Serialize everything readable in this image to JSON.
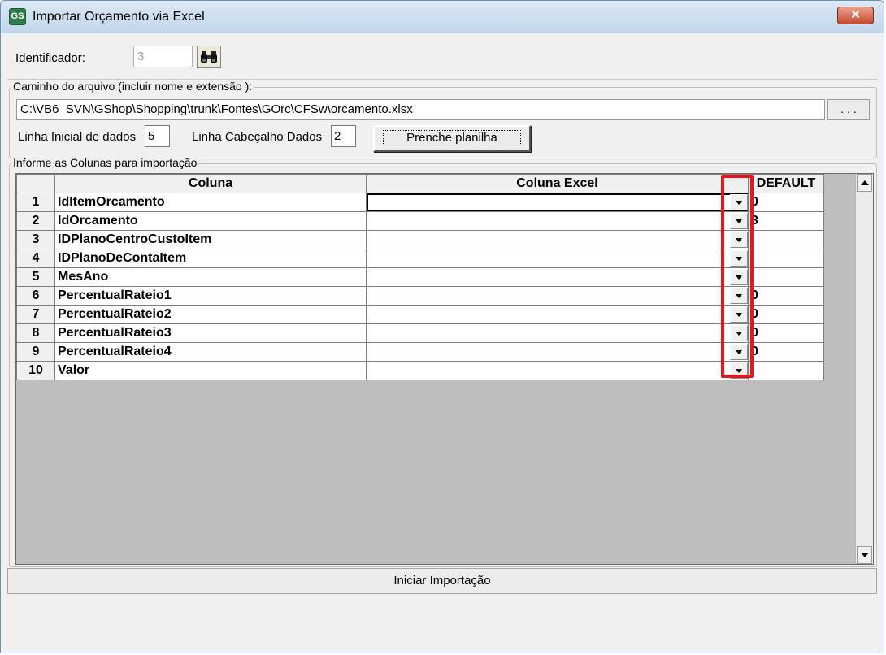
{
  "window": {
    "title": "Importar Orçamento via Excel",
    "app_icon_text": "GS",
    "close_label": "✕"
  },
  "identificador": {
    "label": "Identificador:",
    "value": "3"
  },
  "arquivo": {
    "legend": "Caminho do arquivo (incluir nome e extensão ):",
    "path": "C:\\VB6_SVN\\GShop\\Shopping\\trunk\\Fontes\\GOrc\\CFSw\\orcamento.xlsx",
    "browse_label": ". . .",
    "linha_inicial_label": "Linha Inicial de dados",
    "linha_inicial_value": "5",
    "linha_cabecalho_label": "Linha Cabeçalho Dados",
    "linha_cabecalho_value": "2",
    "prenche_label": "Prenche planilha"
  },
  "colunas": {
    "legend": "Informe as Colunas para importação",
    "headers": {
      "num": "",
      "coluna": "Coluna",
      "excel": "Coluna Excel",
      "default": "DEFAULT"
    },
    "rows": [
      {
        "num": "1",
        "coluna": "IdItemOrcamento",
        "excel": "",
        "default": "0"
      },
      {
        "num": "2",
        "coluna": "IdOrcamento",
        "excel": "",
        "default": "3"
      },
      {
        "num": "3",
        "coluna": "IDPlanoCentroCustoItem",
        "excel": "",
        "default": ""
      },
      {
        "num": "4",
        "coluna": "IDPlanoDeContaItem",
        "excel": "",
        "default": ""
      },
      {
        "num": "5",
        "coluna": "MesAno",
        "excel": "",
        "default": ""
      },
      {
        "num": "6",
        "coluna": "PercentualRateio1",
        "excel": "",
        "default": "0"
      },
      {
        "num": "7",
        "coluna": "PercentualRateio2",
        "excel": "",
        "default": "0"
      },
      {
        "num": "8",
        "coluna": "PercentualRateio3",
        "excel": "",
        "default": "0"
      },
      {
        "num": "9",
        "coluna": "PercentualRateio4",
        "excel": "",
        "default": "0"
      },
      {
        "num": "10",
        "coluna": "Valor",
        "excel": "",
        "default": ""
      }
    ]
  },
  "actions": {
    "iniciar_label": "Iniciar Importação"
  },
  "colors": {
    "highlight": "#e8151c",
    "title_bar": "#c3d7ec",
    "grid_background": "#bebebe"
  },
  "icons": {
    "find": "binoculars-icon",
    "dropdown": "chevron-down-icon",
    "close": "close-icon"
  }
}
